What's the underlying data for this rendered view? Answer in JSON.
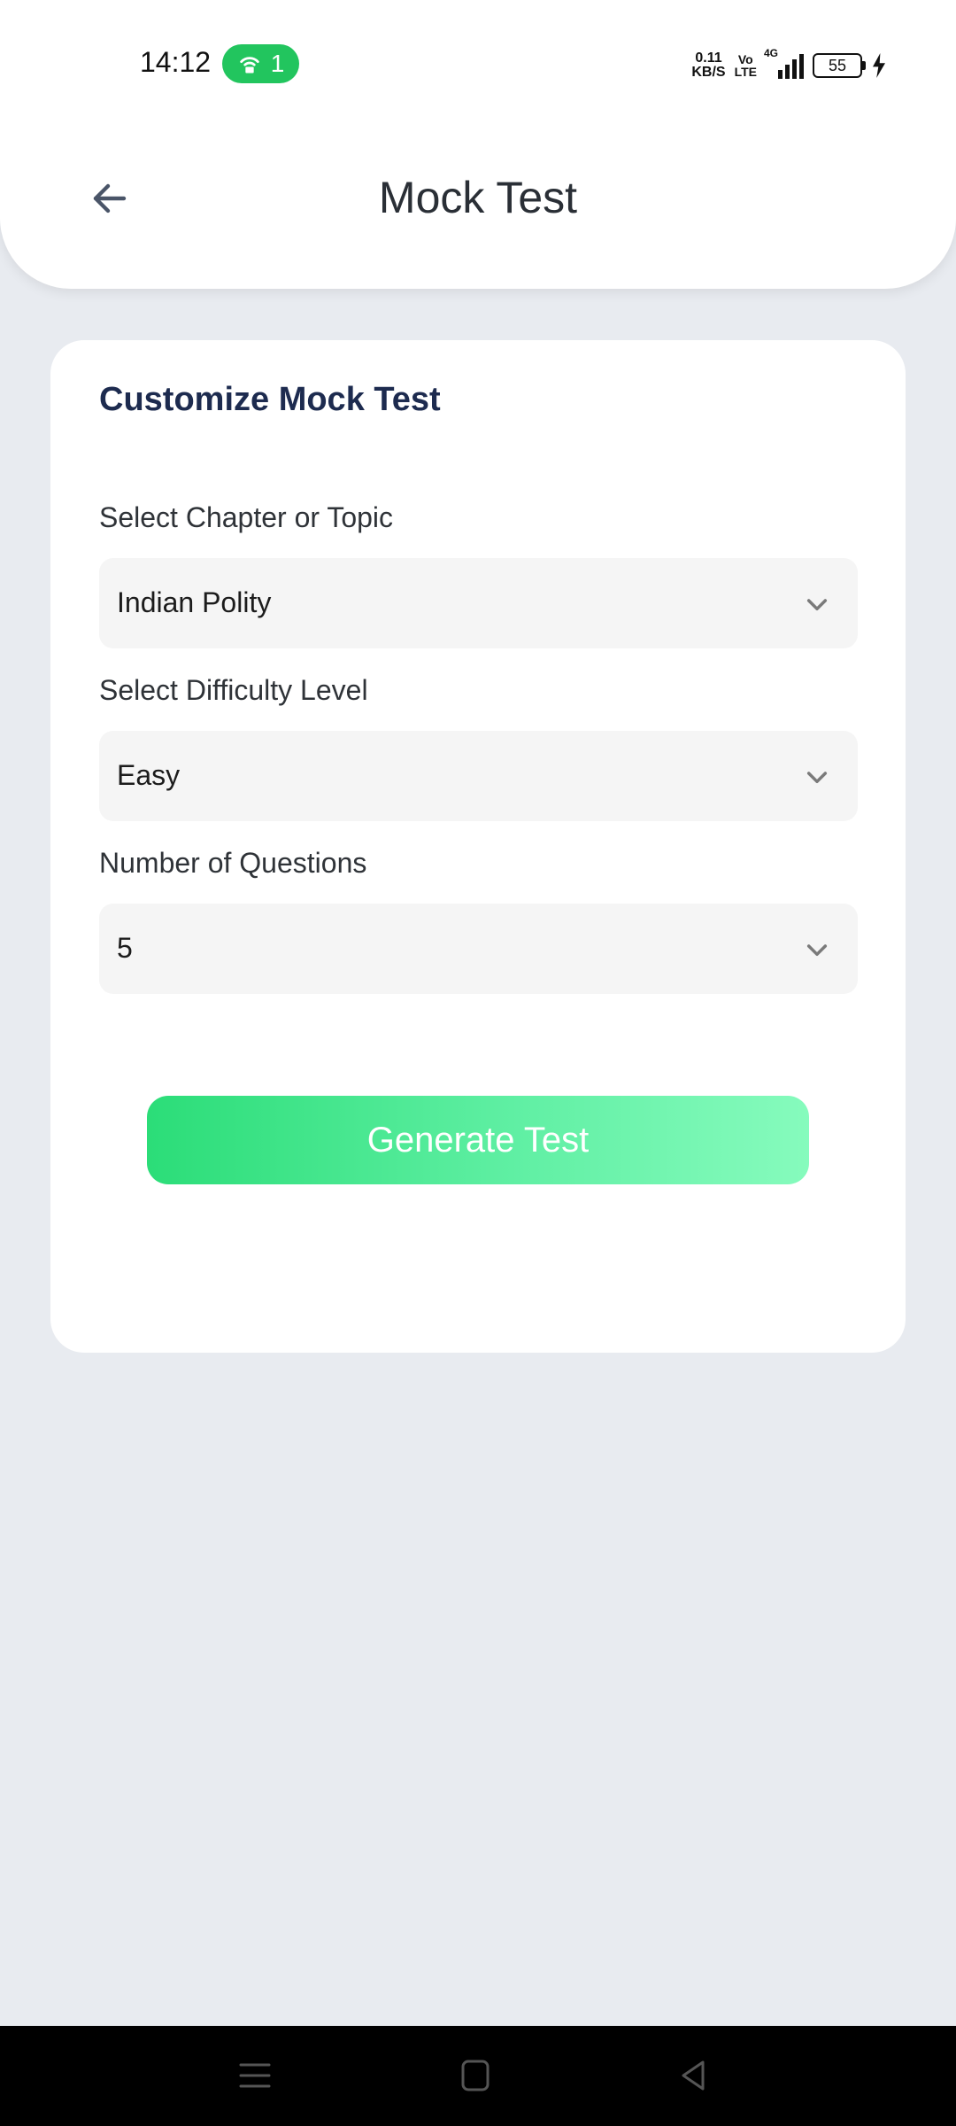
{
  "status_bar": {
    "time": "14:12",
    "hotspot_count": "1",
    "net_speed_value": "0.11",
    "net_speed_unit": "KB/S",
    "volte_top": "Vo",
    "volte_bottom": "LTE",
    "network_type": "4G",
    "battery": "55"
  },
  "header": {
    "title": "Mock Test"
  },
  "card": {
    "title": "Customize Mock Test",
    "chapter": {
      "label": "Select Chapter or Topic",
      "value": "Indian Polity"
    },
    "difficulty": {
      "label": "Select Difficulty Level",
      "value": "Easy"
    },
    "questions": {
      "label": "Number of Questions",
      "value": "5"
    },
    "generate_label": "Generate Test"
  },
  "colors": {
    "accent_start": "#2bdd78",
    "accent_end": "#86fbbd",
    "title_navy": "#1d2b4f",
    "hotspot_green": "#22c55e"
  },
  "icons": {
    "back": "arrow-left-icon",
    "dropdown": "chevron-down-icon",
    "nav_menu": "menu-icon",
    "nav_home": "home-icon",
    "nav_back": "back-triangle-icon"
  }
}
